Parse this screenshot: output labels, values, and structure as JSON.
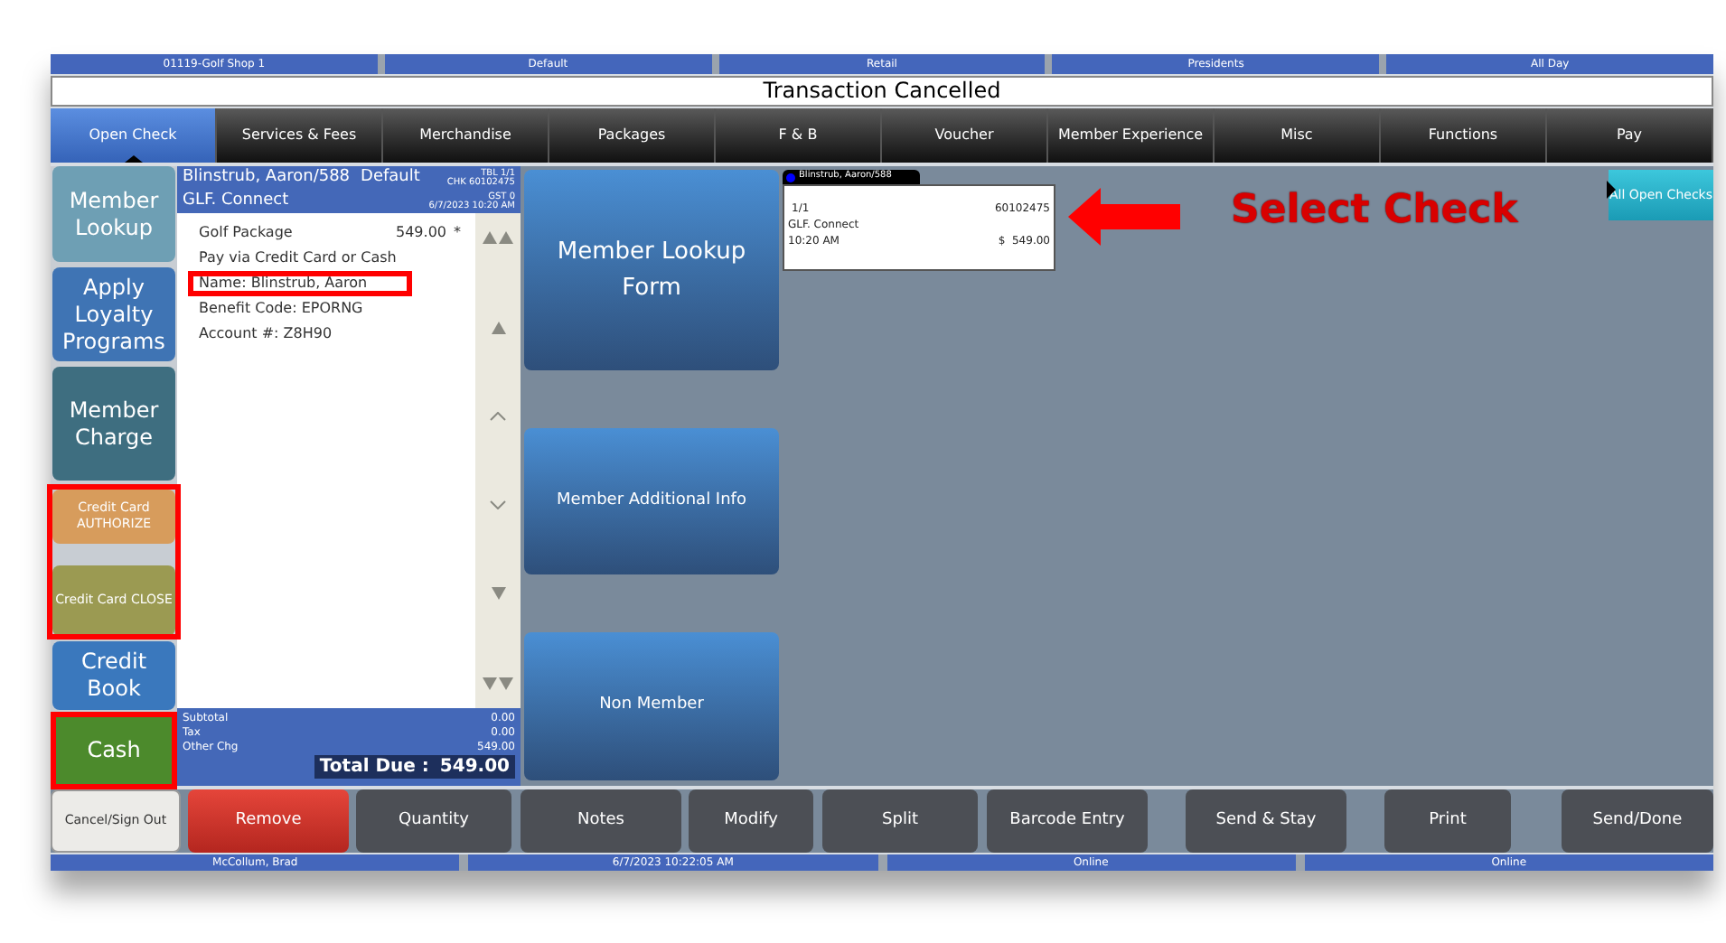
{
  "info_bar": [
    "01119-Golf Shop 1",
    "Default",
    "Retail",
    "Presidents",
    "All Day"
  ],
  "title": "Transaction Cancelled",
  "tabs": [
    {
      "label": "Open Check",
      "selected": true
    },
    {
      "label": "Services & Fees",
      "selected": false
    },
    {
      "label": "Merchandise",
      "selected": false
    },
    {
      "label": "Packages",
      "selected": false
    },
    {
      "label": "F & B",
      "selected": false
    },
    {
      "label": "Voucher",
      "selected": false
    },
    {
      "label": "Member Experience",
      "selected": false
    },
    {
      "label": "Misc",
      "selected": false
    },
    {
      "label": "Functions",
      "selected": false
    },
    {
      "label": "Pay",
      "selected": false
    }
  ],
  "side_buttons": [
    {
      "label": "Member Lookup",
      "kind": "large",
      "color": "#6e9fb4"
    },
    {
      "label": "Apply Loyalty Programs",
      "kind": "large",
      "color": "#3f74b4"
    },
    {
      "label": "Member Charge",
      "kind": "large",
      "color": "#3e6e80"
    },
    {
      "label": "Credit Card AUTHORIZE",
      "kind": "small",
      "color": "#d79c5c"
    },
    {
      "label": "Credit Card CLOSE",
      "kind": "small",
      "color": "#9b9a52"
    },
    {
      "label": "Credit Book",
      "kind": "large",
      "color": "#3a78bd"
    },
    {
      "label": "Cash",
      "kind": "large",
      "color": "#4c8a2c"
    }
  ],
  "check": {
    "guest": "Blinstrub, Aaron/588",
    "profile": "Default",
    "table": "TBL 1/1",
    "check_no": "CHK 60102475",
    "location": "GLF. Connect",
    "guests": "GST 0",
    "opened": "6/7/2023 10:20 AM",
    "items": [
      {
        "text": "Golf Package",
        "amount": "549.00",
        "flag": "*"
      },
      {
        "text": "Pay via Credit Card or Cash"
      },
      {
        "text": "Name: Blinstrub, Aaron",
        "highlighted": true
      },
      {
        "text": "Benefit Code: EPORNG"
      },
      {
        "text": "Account #: Z8H90"
      }
    ],
    "totals": [
      {
        "label": "Subtotal",
        "value": "0.00"
      },
      {
        "label": "Tax",
        "value": "0.00"
      },
      {
        "label": "Other Chg",
        "value": "549.00"
      }
    ],
    "total_due_label": "Total Due :",
    "total_due": "549.00"
  },
  "center_buttons": [
    "Member Lookup Form",
    "Member Additional Info",
    "Non Member"
  ],
  "open_check": {
    "tab": "Blinstrub, Aaron/588",
    "color": "#0000ff",
    "seat": "1/1",
    "number": "60102475",
    "location": "GLF. Connect",
    "time": "10:20 AM",
    "amount": "$  549.00"
  },
  "annotation": "Select Check",
  "all_open_checks": "All Open Checks",
  "bottom_buttons": [
    {
      "label": "Cancel/Sign Out",
      "kind": "light"
    },
    {
      "label": "Remove",
      "kind": "danger"
    },
    {
      "label": "Quantity",
      "kind": "normal"
    },
    {
      "label": "Notes",
      "kind": "normal"
    },
    {
      "label": "Modify",
      "kind": "normal"
    },
    {
      "label": "Split",
      "kind": "normal"
    },
    {
      "label": "Barcode Entry",
      "kind": "normal"
    },
    {
      "label": "Send & Stay",
      "kind": "normal"
    },
    {
      "label": "Print",
      "kind": "normal"
    },
    {
      "label": "Send/Done",
      "kind": "normal"
    }
  ],
  "status_bar": [
    "McCollum, Brad",
    "6/7/2023 10:22:05 AM",
    "Online",
    "Online"
  ]
}
